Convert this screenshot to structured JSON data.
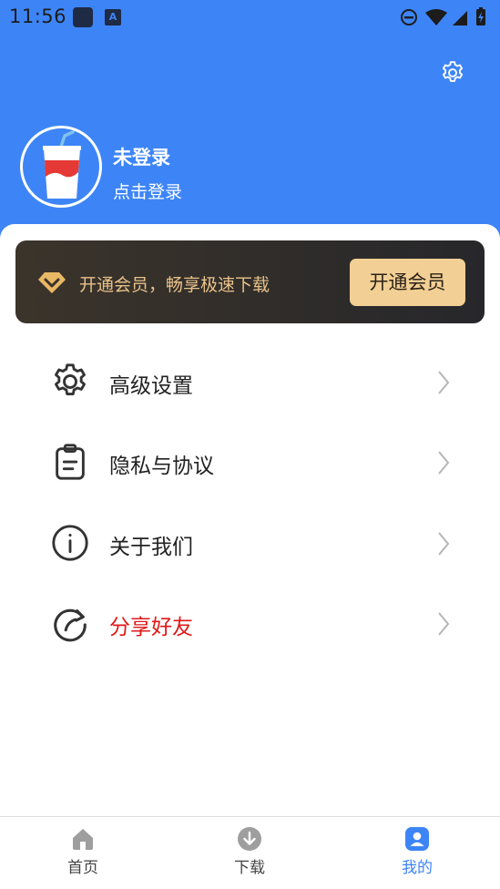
{
  "status_bar": {
    "time": "11:56",
    "notif_app_letter": "A"
  },
  "profile": {
    "title": "未登录",
    "subtitle": "点击登录"
  },
  "vip": {
    "text": "开通会员，畅享极速下载",
    "button_label": "开通会员"
  },
  "menu": [
    {
      "label": "高级设置",
      "icon": "gear-icon"
    },
    {
      "label": "隐私与协议",
      "icon": "clipboard-icon"
    },
    {
      "label": "关于我们",
      "icon": "info-icon"
    },
    {
      "label": "分享好友",
      "icon": "share-icon",
      "color": "#e01818"
    }
  ],
  "bottom_nav": [
    {
      "label": "首页",
      "icon": "home-icon"
    },
    {
      "label": "下载",
      "icon": "download-icon"
    },
    {
      "label": "我的",
      "icon": "user-icon",
      "active": true
    }
  ],
  "colors": {
    "primary": "#3d85f7",
    "vip_gold": "#f2cf94",
    "vip_text": "#e9c28a",
    "share_red": "#e01818"
  }
}
